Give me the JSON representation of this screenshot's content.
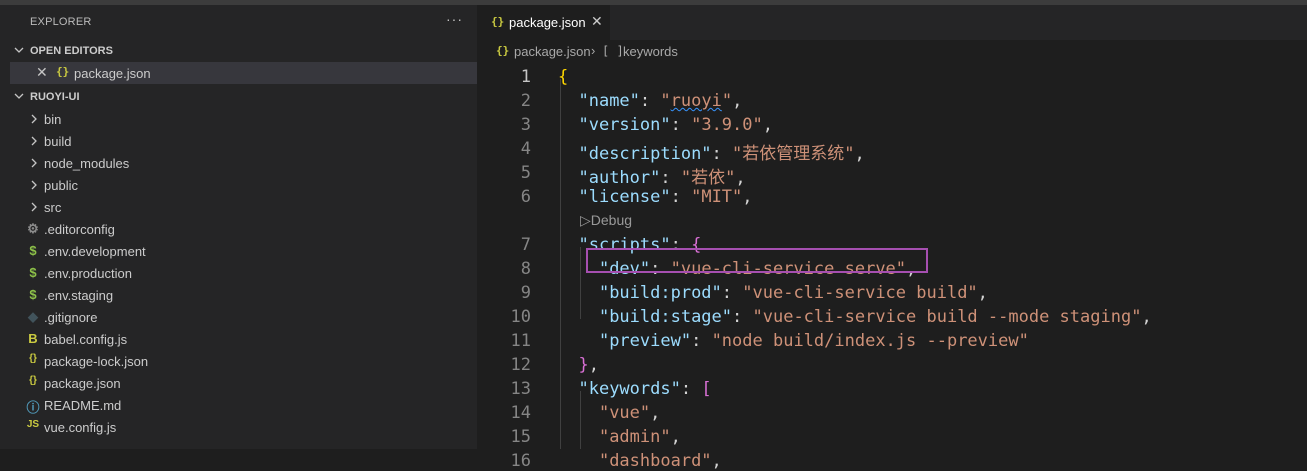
{
  "sidebar": {
    "title": "EXPLORER",
    "more": "···",
    "open_editors": {
      "label": "OPEN EDITORS",
      "items": [
        {
          "icon": "{}",
          "name": "package.json",
          "close": "✕"
        }
      ]
    },
    "project": {
      "label": "RUOYI-UI",
      "folders": [
        "bin",
        "build",
        "node_modules",
        "public",
        "src"
      ],
      "files": [
        {
          "name": ".editorconfig",
          "icon": "⚙",
          "icon_name": "gear-icon",
          "color": "#8c8c8c"
        },
        {
          "name": ".env.development",
          "icon": "$",
          "icon_name": "dollar-icon",
          "color": "#8dc149"
        },
        {
          "name": ".env.production",
          "icon": "$",
          "icon_name": "dollar-icon",
          "color": "#8dc149"
        },
        {
          "name": ".env.staging",
          "icon": "$",
          "icon_name": "dollar-icon",
          "color": "#8dc149"
        },
        {
          "name": ".gitignore",
          "icon": "◆",
          "icon_name": "git-icon",
          "color": "#41535b"
        },
        {
          "name": "babel.config.js",
          "icon": "B",
          "icon_name": "babel-icon",
          "color": "#cbcb41"
        },
        {
          "name": "package-lock.json",
          "icon": "{}",
          "icon_name": "json-icon",
          "color": "#cbcb41"
        },
        {
          "name": "package.json",
          "icon": "{}",
          "icon_name": "json-icon",
          "color": "#cbcb41"
        },
        {
          "name": "README.md",
          "icon": "ⓘ",
          "icon_name": "info-icon",
          "color": "#519aba"
        },
        {
          "name": "vue.config.js",
          "icon": "JS",
          "icon_name": "js-icon",
          "color": "#cbcb41"
        }
      ]
    }
  },
  "editor": {
    "tab": {
      "icon": "{}",
      "title": "package.json",
      "close": "✕"
    },
    "breadcrumb": {
      "icon": "{}",
      "file": "package.json",
      "separator": "›",
      "symbol_icon": "[ ]",
      "symbol": "keywords"
    },
    "codelens": "Debug",
    "lines": [
      {
        "n": "1",
        "tokens": [
          [
            "b1",
            "{"
          ]
        ]
      },
      {
        "n": "2",
        "tokens": [
          [
            "p",
            "  "
          ],
          [
            "k",
            "\"name\""
          ],
          [
            "p",
            ": "
          ],
          [
            "s",
            "\""
          ],
          [
            "sq",
            "ruoyi"
          ],
          [
            "s",
            "\""
          ],
          [
            "p",
            ","
          ]
        ]
      },
      {
        "n": "3",
        "tokens": [
          [
            "p",
            "  "
          ],
          [
            "k",
            "\"version\""
          ],
          [
            "p",
            ": "
          ],
          [
            "s",
            "\"3.9.0\""
          ],
          [
            "p",
            ","
          ]
        ]
      },
      {
        "n": "4",
        "tokens": [
          [
            "p",
            "  "
          ],
          [
            "k",
            "\"description\""
          ],
          [
            "p",
            ": "
          ],
          [
            "s",
            "\"若依管理系统\""
          ],
          [
            "p",
            ","
          ]
        ]
      },
      {
        "n": "5",
        "tokens": [
          [
            "p",
            "  "
          ],
          [
            "k",
            "\"author\""
          ],
          [
            "p",
            ": "
          ],
          [
            "s",
            "\"若依\""
          ],
          [
            "p",
            ","
          ]
        ]
      },
      {
        "n": "6",
        "tokens": [
          [
            "p",
            "  "
          ],
          [
            "k",
            "\"license\""
          ],
          [
            "p",
            ": "
          ],
          [
            "s",
            "\"MIT\""
          ],
          [
            "p",
            ","
          ]
        ]
      },
      {
        "n": "7",
        "tokens": [
          [
            "p",
            "  "
          ],
          [
            "k",
            "\"scripts\""
          ],
          [
            "p",
            ": "
          ],
          [
            "b2",
            "{"
          ]
        ]
      },
      {
        "n": "8",
        "tokens": [
          [
            "p",
            "    "
          ],
          [
            "k",
            "\"dev\""
          ],
          [
            "p",
            ": "
          ],
          [
            "s",
            "\"vue-cli-service serve\""
          ],
          [
            "p",
            ","
          ]
        ]
      },
      {
        "n": "9",
        "tokens": [
          [
            "p",
            "    "
          ],
          [
            "k",
            "\"build:prod\""
          ],
          [
            "p",
            ": "
          ],
          [
            "s",
            "\"vue-cli-service build\""
          ],
          [
            "p",
            ","
          ]
        ]
      },
      {
        "n": "10",
        "tokens": [
          [
            "p",
            "    "
          ],
          [
            "k",
            "\"build:stage\""
          ],
          [
            "p",
            ": "
          ],
          [
            "s",
            "\"vue-cli-service build --mode staging\""
          ],
          [
            "p",
            ","
          ]
        ]
      },
      {
        "n": "11",
        "tokens": [
          [
            "p",
            "    "
          ],
          [
            "k",
            "\"preview\""
          ],
          [
            "p",
            ": "
          ],
          [
            "s",
            "\"node build/index.js --preview\""
          ]
        ]
      },
      {
        "n": "12",
        "tokens": [
          [
            "p",
            "  "
          ],
          [
            "b2",
            "}"
          ],
          [
            "p",
            ","
          ]
        ]
      },
      {
        "n": "13",
        "tokens": [
          [
            "p",
            "  "
          ],
          [
            "k",
            "\"keywords\""
          ],
          [
            "p",
            ": "
          ],
          [
            "b2",
            "["
          ]
        ]
      },
      {
        "n": "14",
        "tokens": [
          [
            "p",
            "    "
          ],
          [
            "s",
            "\"vue\""
          ],
          [
            "p",
            ","
          ]
        ]
      },
      {
        "n": "15",
        "tokens": [
          [
            "p",
            "    "
          ],
          [
            "s",
            "\"admin\""
          ],
          [
            "p",
            ","
          ]
        ]
      },
      {
        "n": "16",
        "tokens": [
          [
            "p",
            "    "
          ],
          [
            "s",
            "\"dashboard\""
          ],
          [
            "p",
            ","
          ]
        ]
      }
    ]
  }
}
